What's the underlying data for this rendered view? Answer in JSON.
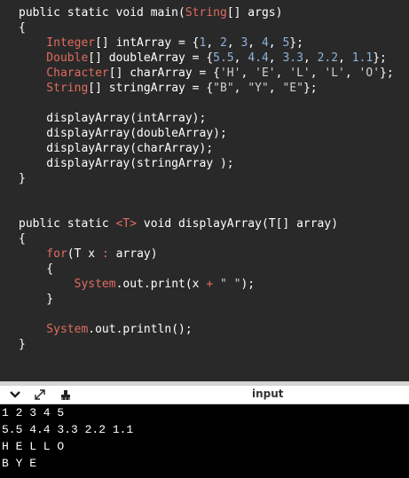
{
  "editor": {
    "lines": [
      {
        "segments": [
          [
            "kw",
            "public static void main("
          ],
          [
            "type",
            "String"
          ],
          [
            "kw",
            "[] args)"
          ]
        ]
      },
      {
        "segments": [
          [
            "kw",
            "{"
          ]
        ]
      },
      {
        "segments": [
          [
            "type",
            "    Integer"
          ],
          [
            "kw",
            "[] intArray = {"
          ],
          [
            "num",
            "1"
          ],
          [
            "kw",
            ", "
          ],
          [
            "num",
            "2"
          ],
          [
            "kw",
            ", "
          ],
          [
            "num",
            "3"
          ],
          [
            "kw",
            ", "
          ],
          [
            "num",
            "4"
          ],
          [
            "kw",
            ", "
          ],
          [
            "num",
            "5"
          ],
          [
            "kw",
            "};"
          ]
        ]
      },
      {
        "segments": [
          [
            "type",
            "    Double"
          ],
          [
            "kw",
            "[] doubleArray = {"
          ],
          [
            "num",
            "5.5"
          ],
          [
            "kw",
            ", "
          ],
          [
            "num",
            "4.4"
          ],
          [
            "kw",
            ", "
          ],
          [
            "num",
            "3.3"
          ],
          [
            "kw",
            ", "
          ],
          [
            "num",
            "2.2"
          ],
          [
            "kw",
            ", "
          ],
          [
            "num",
            "1.1"
          ],
          [
            "kw",
            "};"
          ]
        ]
      },
      {
        "segments": [
          [
            "type",
            "    Character"
          ],
          [
            "kw",
            "[] charArray = {"
          ],
          [
            "str",
            "'H'"
          ],
          [
            "kw",
            ", "
          ],
          [
            "str",
            "'E'"
          ],
          [
            "kw",
            ", "
          ],
          [
            "str",
            "'L'"
          ],
          [
            "kw",
            ", "
          ],
          [
            "str",
            "'L'"
          ],
          [
            "kw",
            ", "
          ],
          [
            "str",
            "'O'"
          ],
          [
            "kw",
            "};"
          ]
        ]
      },
      {
        "segments": [
          [
            "type",
            "    String"
          ],
          [
            "kw",
            "[] stringArray = {"
          ],
          [
            "str",
            "\"B\""
          ],
          [
            "kw",
            ", "
          ],
          [
            "str",
            "\"Y\""
          ],
          [
            "kw",
            ", "
          ],
          [
            "str",
            "\"E\""
          ],
          [
            "kw",
            "};"
          ]
        ]
      },
      {
        "segments": [
          [
            "kw",
            ""
          ]
        ]
      },
      {
        "segments": [
          [
            "kw",
            "    displayArray(intArray);"
          ]
        ]
      },
      {
        "segments": [
          [
            "kw",
            "    displayArray(doubleArray);"
          ]
        ]
      },
      {
        "segments": [
          [
            "kw",
            "    displayArray(charArray);"
          ]
        ]
      },
      {
        "segments": [
          [
            "kw",
            "    displayArray(stringArray );"
          ]
        ]
      },
      {
        "segments": [
          [
            "kw",
            "}"
          ]
        ]
      },
      {
        "segments": [
          [
            "kw",
            ""
          ]
        ]
      },
      {
        "segments": [
          [
            "kw",
            ""
          ]
        ]
      },
      {
        "segments": [
          [
            "kw",
            "public static "
          ],
          [
            "op",
            "<T>"
          ],
          [
            "kw",
            " void displayArray(T[] array)"
          ]
        ]
      },
      {
        "segments": [
          [
            "kw",
            "{"
          ]
        ]
      },
      {
        "segments": [
          [
            "type",
            "    for"
          ],
          [
            "kw",
            "(T x "
          ],
          [
            "op",
            ":"
          ],
          [
            "kw",
            " array)"
          ]
        ]
      },
      {
        "segments": [
          [
            "kw",
            "    {"
          ]
        ]
      },
      {
        "segments": [
          [
            "sys",
            "        System"
          ],
          [
            "kw",
            ".out.print(x "
          ],
          [
            "op",
            "+"
          ],
          [
            "kw",
            " "
          ],
          [
            "str",
            "\" \""
          ],
          [
            "kw",
            ");"
          ]
        ]
      },
      {
        "segments": [
          [
            "kw",
            "    }"
          ]
        ]
      },
      {
        "segments": [
          [
            "kw",
            ""
          ]
        ]
      },
      {
        "segments": [
          [
            "sys",
            "    System"
          ],
          [
            "kw",
            ".out.println();"
          ]
        ]
      },
      {
        "segments": [
          [
            "kw",
            "}"
          ]
        ]
      }
    ]
  },
  "toolbar": {
    "title": "input",
    "icons": [
      "chevron-down-icon",
      "expand-icon",
      "clear-console-icon"
    ]
  },
  "console": {
    "output": [
      "1 2 3 4 5",
      "5.5 4.4 3.3 2.2 1.1",
      "H E L L O",
      "B Y E"
    ]
  }
}
